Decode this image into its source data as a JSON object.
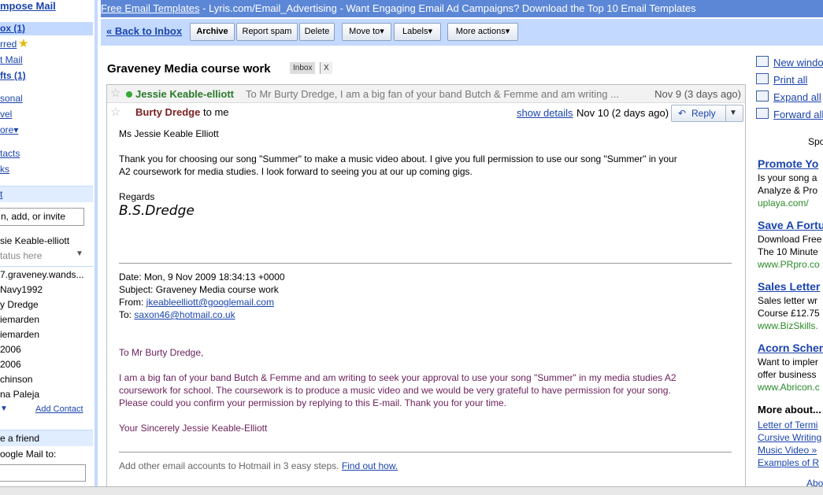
{
  "leftnav": {
    "compose": "mpose Mail",
    "inbox": "ox (1)",
    "starred": "rred",
    "sent": "t Mail",
    "drafts": "fts (1)",
    "personal": "sonal",
    "travel": "vel",
    "more": "ore▾",
    "contacts": "tacts",
    "tasks": "ks",
    "chat_header": "t",
    "search_placeholder": "n, add, or invite",
    "me_name": "sie Keable-elliott",
    "status_placeholder": "tatus here",
    "chat_contacts": [
      "7.graveney.wands...",
      "Navy1992",
      "y Dredge",
      "iemarden",
      "iemarden",
      "2006",
      "2006",
      "chinson",
      "na Paleja"
    ],
    "add_contact": "Add Contact",
    "invite_header": "e a friend",
    "invite_label": "oogle Mail to:"
  },
  "topad": {
    "link": "Free Email Templates",
    "text": " - Lyris.com/Email_Advertising - Want Engaging Email Ad Campaigns? Download the Top 10 Email Templates"
  },
  "toolbar": {
    "back": "« Back to Inbox",
    "archive": "Archive",
    "report_spam": "Report spam",
    "delete": "Delete",
    "move_to": "Move to▾",
    "labels": "Labels▾",
    "more_actions": "More actions▾"
  },
  "thread": {
    "subject": "Graveney Media course work",
    "label": "Inbox",
    "label_close": "X"
  },
  "collapsed_message": {
    "sender": "Jessie Keable-elliott",
    "snippet": "To Mr Burty Dredge, I am a big fan of your band Butch & Femme and am writing ...",
    "date": "Nov 9 (3 days ago)"
  },
  "message": {
    "sender": "Burty Dredge",
    "to": "to me",
    "show_details": "show details",
    "date": "Nov 10 (2 days ago)",
    "reply": "Reply",
    "greeting": "Ms Jessie Keable Elliott",
    "body1": "Thank you for choosing our song \"Summer\" to make a music video about. I give you full permission to use our song \"Summer\" in your",
    "body2": "A2 coursework for media studies. I look forward to seeing you at our up coming gigs.",
    "regards": "Regards",
    "signature": "B.S.Dredge",
    "quoted_date": "Date: Mon, 9 Nov 2009 18:34:13 +0000",
    "quoted_subject": "Subject: Graveney Media course work",
    "quoted_from_label": "From: ",
    "quoted_from": "jkeableelliott@googlemail.com",
    "quoted_to_label": "To: ",
    "quoted_to": "saxon46@hotmail.co.uk",
    "q_greeting": "To Mr Burty Dredge,",
    "q_body1": "I am a big fan of your band Butch & Femme and am writing to seek your approval to use your song \"Summer\" in my media studies A2",
    "q_body2": "coursework for school. The coursework is to produce a music video and we would be very grateful to have permission for your song.",
    "q_body3": "Please could you confirm your permission by replying to this E-mail. Thank you for your time.",
    "q_closing": "Your Sincerely Jessie Keable-Elliott",
    "footer_text": "Add other email accounts to Hotmail in 3 easy steps. ",
    "footer_link": "Find out how."
  },
  "rightcol": {
    "new_window": "New windo",
    "print_all": "Print all",
    "expand_all": "Expand all",
    "forward_all": "Forward all",
    "sponsored": "Spo",
    "ads": [
      {
        "title": "Promote Yo",
        "lines": [
          "Is your song a",
          "Analyze & Pro"
        ],
        "url": "uplaya.com/"
      },
      {
        "title": "Save A Fortu",
        "lines": [
          "Download Free",
          "The 10 Minute"
        ],
        "url": "www.PRpro.co"
      },
      {
        "title": "Sales Letter",
        "lines": [
          "Sales letter wr",
          "Course £12.75"
        ],
        "url": "www.BizSkills."
      },
      {
        "title": "Acorn Schem",
        "lines": [
          "Want to impler",
          "offer business"
        ],
        "url": "www.Abricon.c"
      }
    ],
    "more_about": "More about...",
    "more_links": [
      "Letter of Termi",
      "Cursive Writing",
      "Music Video »",
      "Examples of R"
    ],
    "about": "Abo"
  },
  "colors": {
    "toolbar_bg": "#c3d9ff",
    "topad_bg": "#5c87d6",
    "link": "#1a44ad",
    "quoted_text": "#6b1f5a",
    "ad_url": "#2a8a2a"
  }
}
